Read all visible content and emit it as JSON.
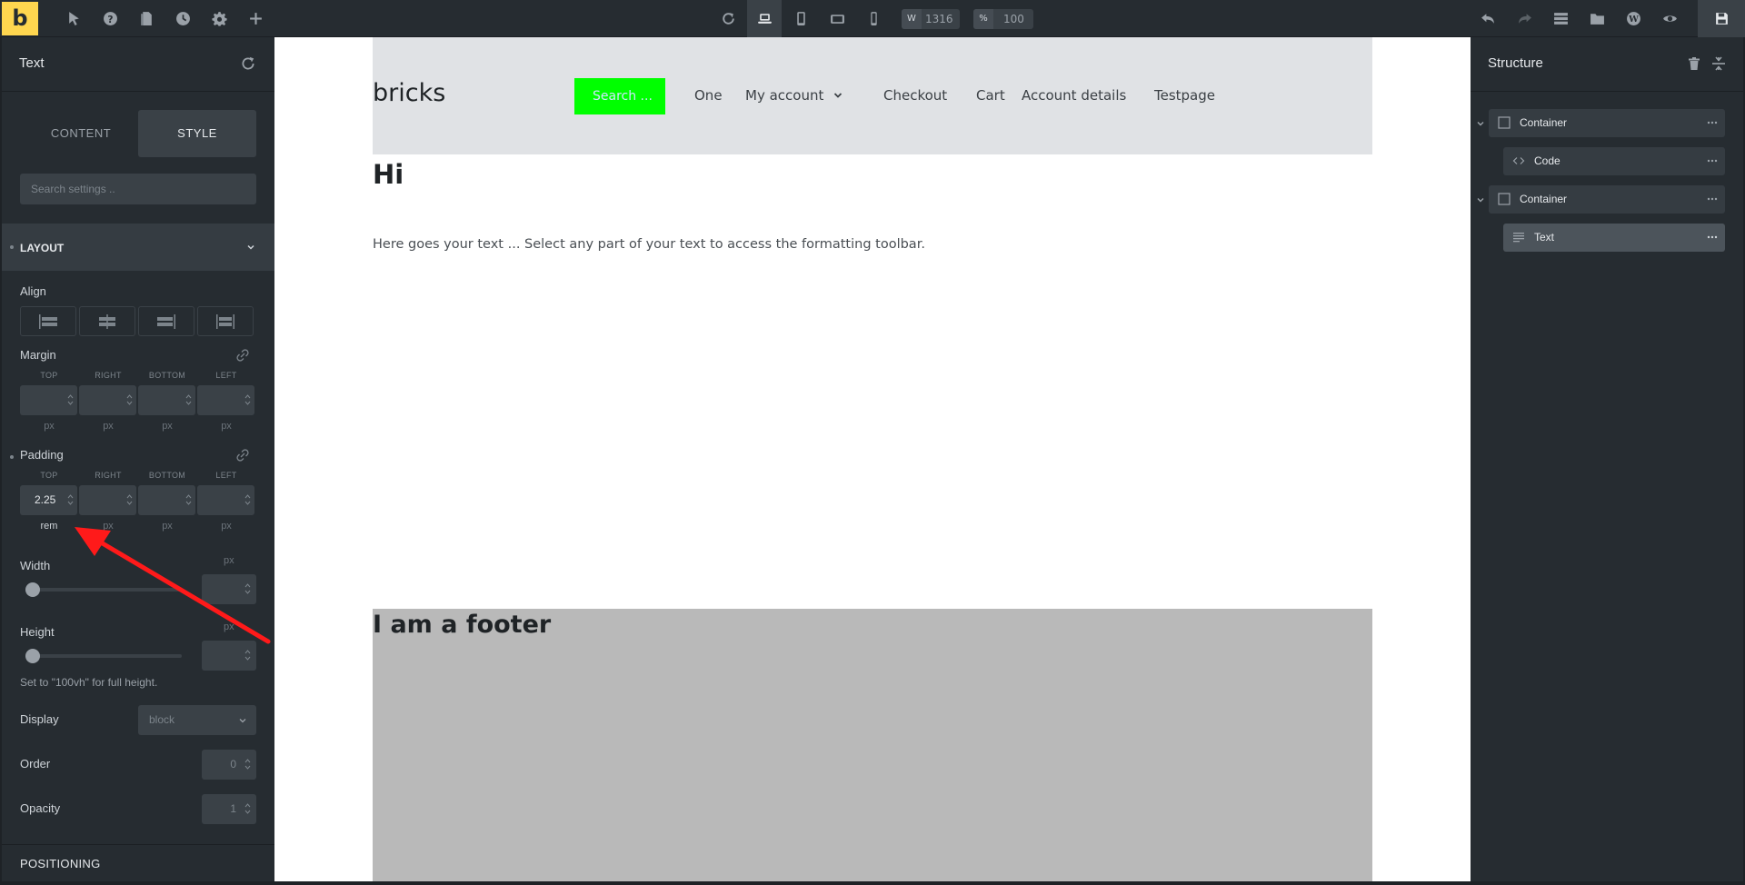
{
  "toolbar": {
    "logo": "b",
    "width_label": "W",
    "width_value": "1316",
    "zoom_label": "%",
    "zoom_value": "100"
  },
  "left_panel": {
    "title": "Text",
    "tabs": [
      {
        "label": "CONTENT",
        "active": false
      },
      {
        "label": "STYLE",
        "active": true
      }
    ],
    "search_placeholder": "Search settings ..",
    "layout_section": "LAYOUT",
    "align_label": "Align",
    "margin": {
      "label": "Margin",
      "sides": [
        "TOP",
        "RIGHT",
        "BOTTOM",
        "LEFT"
      ],
      "values": [
        "",
        "",
        "",
        ""
      ],
      "units": [
        "px",
        "px",
        "px",
        "px"
      ]
    },
    "padding": {
      "label": "Padding",
      "sides": [
        "TOP",
        "RIGHT",
        "BOTTOM",
        "LEFT"
      ],
      "values": [
        "2.25",
        "",
        "",
        ""
      ],
      "units": [
        "rem",
        "px",
        "px",
        "px"
      ]
    },
    "width": {
      "label": "Width",
      "unit": "px",
      "value": ""
    },
    "height": {
      "label": "Height",
      "unit": "px",
      "value": ""
    },
    "height_hint": "Set to \"100vh\" for full height.",
    "display": {
      "label": "Display",
      "value": "block"
    },
    "order": {
      "label": "Order",
      "value": "0"
    },
    "opacity": {
      "label": "Opacity",
      "value": "1"
    },
    "positioning_section": "POSITIONING"
  },
  "canvas": {
    "site_logo": "bricks",
    "search_label": "Search ...",
    "nav": [
      "One",
      "My account",
      "Checkout",
      "Cart",
      "Account details",
      "Testpage"
    ],
    "heading": "Hi",
    "text": "Here goes your text ... Select any part of your text to access the formatting toolbar.",
    "footer_heading": "I am a footer"
  },
  "structure": {
    "title": "Structure",
    "items": [
      {
        "label": "Container",
        "type": "container",
        "level": 0
      },
      {
        "label": "Code",
        "type": "code",
        "level": 1
      },
      {
        "label": "Container",
        "type": "container",
        "level": 0
      },
      {
        "label": "Text",
        "type": "text",
        "level": 1,
        "selected": true
      }
    ]
  },
  "colors": {
    "brand_yellow": "#ffd64f",
    "search_green": "#00ff00",
    "annotation_red": "#ff1a1a"
  }
}
